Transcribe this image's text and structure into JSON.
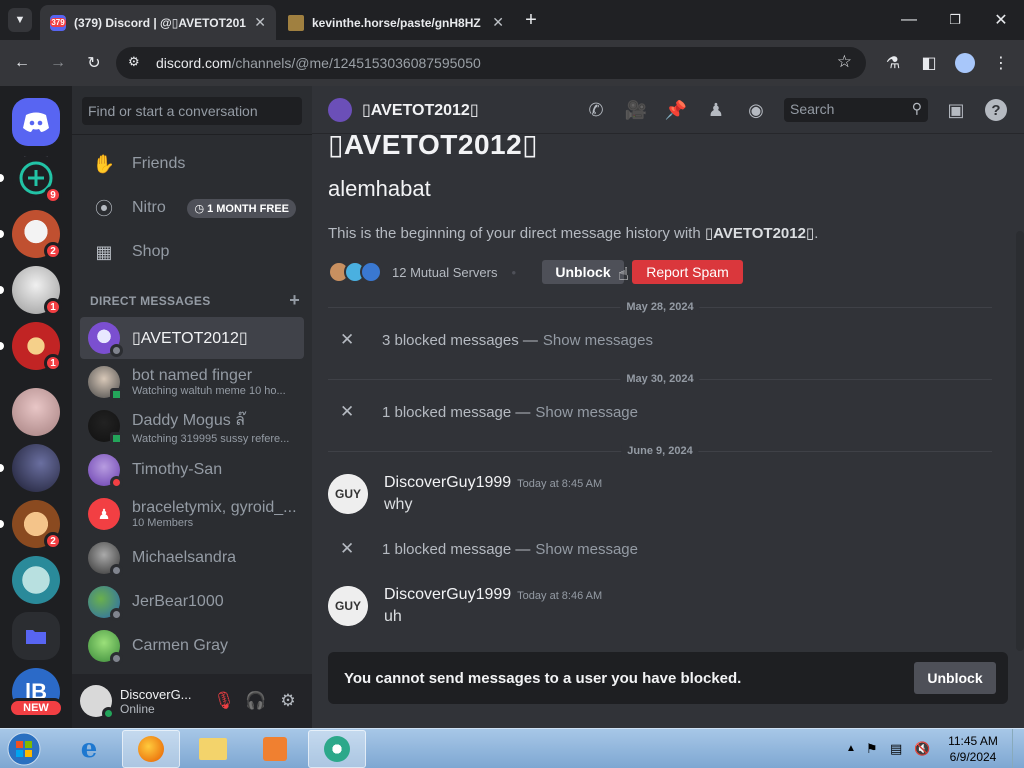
{
  "browser": {
    "tabs": [
      {
        "title": "(379) Discord | @▯AVETOT201",
        "favicon_text": "379"
      },
      {
        "title": "kevinthe.horse/paste/gnH8HZ"
      }
    ],
    "url_host": "discord.com",
    "url_path": "/channels/@me/1245153036087595050"
  },
  "servers": [
    {
      "name": "home",
      "badge": ""
    },
    {
      "name": "add",
      "badge": "9"
    },
    {
      "name": "s1",
      "badge": "2"
    },
    {
      "name": "s2",
      "badge": "1"
    },
    {
      "name": "s3",
      "badge": "1"
    },
    {
      "name": "s4",
      "badge": ""
    },
    {
      "name": "s5",
      "badge": ""
    },
    {
      "name": "s6",
      "badge": "2"
    },
    {
      "name": "s7",
      "badge": ""
    },
    {
      "name": "folder",
      "badge": ""
    },
    {
      "name": "s8",
      "badge": "NEW"
    }
  ],
  "sidebar": {
    "search_placeholder": "Find or start a conversation",
    "friends": "Friends",
    "nitro": "Nitro",
    "nitro_badge": "1 MONTH FREE",
    "shop": "Shop",
    "dm_header": "DIRECT MESSAGES",
    "dms": [
      {
        "name": "▯AVETOT2012▯",
        "sub": ""
      },
      {
        "name": "bot named finger",
        "sub": "Watching waltuh meme 10 ho..."
      },
      {
        "name": "Daddy Mogus ล๊",
        "sub": "Watching 319995 sussy refere..."
      },
      {
        "name": "Timothy-San",
        "sub": ""
      },
      {
        "name": "braceletymix, gyroid_...",
        "sub": "10 Members"
      },
      {
        "name": "Michaelsandra",
        "sub": ""
      },
      {
        "name": "JerBear1000",
        "sub": ""
      },
      {
        "name": "Carmen Gray",
        "sub": ""
      }
    ],
    "user_name": "DiscoverG...",
    "user_status": "Online"
  },
  "chat": {
    "header_title": "▯AVETOT2012▯",
    "search_placeholder": "Search",
    "big_name": "▯AVETOT2012▯",
    "username": "alemhabat",
    "beginning_prefix": "This is the beginning of your direct message history with ",
    "beginning_name": "▯AVETOT2012▯",
    "beginning_suffix": ".",
    "mutual_servers": "12 Mutual Servers",
    "unblock": "Unblock",
    "report_spam": "Report Spam",
    "dates": [
      "May 28, 2024",
      "May 30, 2024",
      "June 9, 2024"
    ],
    "blocked": [
      {
        "text": "3 blocked messages —",
        "link": "Show messages"
      },
      {
        "text": "1 blocked message —",
        "link": "Show message"
      },
      {
        "text": "1 blocked message —",
        "link": "Show message"
      }
    ],
    "messages": [
      {
        "author": "DiscoverGuy1999",
        "time": "Today at 8:45 AM",
        "text": "why"
      },
      {
        "author": "DiscoverGuy1999",
        "time": "Today at 8:46 AM",
        "text": "uh"
      }
    ],
    "blocked_notice": "You cannot send messages to a user you have blocked.",
    "unblock_bottom": "Unblock"
  },
  "taskbar": {
    "time": "11:45 AM",
    "date": "6/9/2024"
  }
}
